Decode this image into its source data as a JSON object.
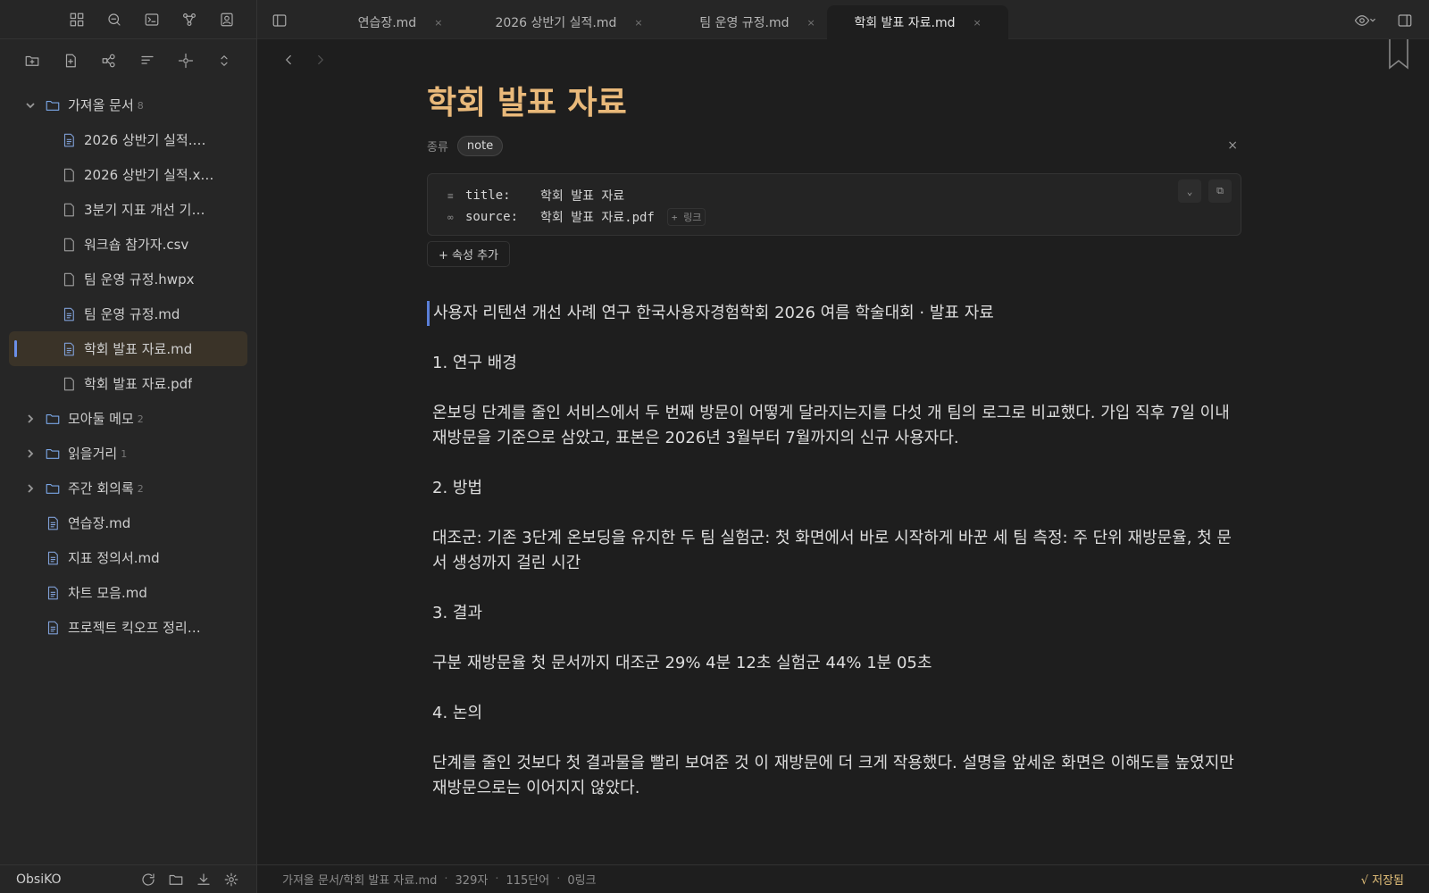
{
  "tabs": [
    {
      "label": "연습장.md",
      "close": "×"
    },
    {
      "label": "2026 상반기 실적.md",
      "close": "×"
    },
    {
      "label": "팀 운영 규정.md",
      "close": "×"
    },
    {
      "label": "학회 발표 자료.md",
      "close": "×"
    }
  ],
  "tree": [
    {
      "label": "가져올 문서",
      "count": "8"
    },
    {
      "label": "2026 상반기 실적.…"
    },
    {
      "label": "2026 상반기 실적.x…"
    },
    {
      "label": "3분기 지표 개선 기…"
    },
    {
      "label": "워크숍 참가자.csv"
    },
    {
      "label": "팀 운영 규정.hwpx"
    },
    {
      "label": "팀 운영 규정.md"
    },
    {
      "label": "학회 발표 자료.md"
    },
    {
      "label": "학회 발표 자료.pdf"
    },
    {
      "label": "모아둘 메모",
      "count": "2"
    },
    {
      "label": "읽을거리",
      "count": "1"
    },
    {
      "label": "주간 회의록",
      "count": "2"
    },
    {
      "label": "연습장.md"
    },
    {
      "label": "지표 정의서.md"
    },
    {
      "label": "차트 모음.md"
    },
    {
      "label": "프로젝트 킥오프 정리.…"
    }
  ],
  "vault_name": "ObsiKO",
  "doc": {
    "title": "학회 발표 자료",
    "type_label": "종류",
    "type_value": "note",
    "close": "×",
    "props": [
      {
        "key": "title:",
        "value": "학회 발표 자료"
      },
      {
        "key": "source:",
        "value": "학회 발표 자료.pdf",
        "link": "+ 링크"
      }
    ],
    "add_property": "+ 속성 추가",
    "paragraphs": [
      "사용자 리텐션 개선 사례 연구 한국사용자경험학회 2026 여름 학술대회 · 발표 자료",
      "1. 연구 배경",
      "온보딩 단계를 줄인 서비스에서 두 번째 방문이 어떻게 달라지는지를 다섯 개 팀의 로그로 비교했다. 가입 직후 7일 이내 재방문을 기준으로 삼았고, 표본은 2026년 3월부터 7월까지의 신규 사용자다.",
      "2. 방법",
      "대조군: 기존 3단계 온보딩을 유지한 두 팀 실험군: 첫 화면에서 바로 시작하게 바꾼 세 팀 측정: 주 단위 재방문율, 첫 문서 생성까지 걸린 시간",
      "3. 결과",
      "구분 재방문율 첫 문서까지 대조군 29% 4분 12초 실험군 44% 1분 05초",
      "4. 논의",
      "단계를 줄인 것보다 첫 결과물을 빨리 보여준 것 이 재방문에 더 크게 작용했다. 설명을 앞세운 화면은 이해도를 높였지만 재방문으로는 이어지지 않았다."
    ]
  },
  "status": {
    "path": "가져올 문서/학회 발표 자료.md",
    "chars": "329자",
    "words": "115단어",
    "links": "0링크",
    "saved": "√ 저장됨"
  }
}
